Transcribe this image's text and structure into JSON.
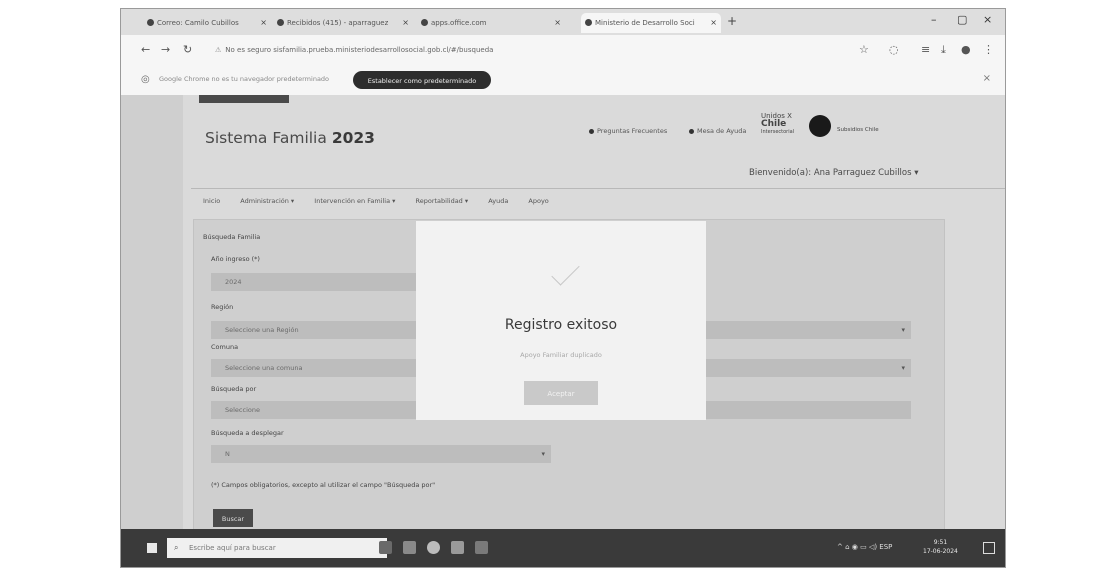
{
  "browser": {
    "tabs": [
      {
        "label": "Correo: Camilo Cubillos"
      },
      {
        "label": "Recibidos (415) - aparraguez"
      },
      {
        "label": "apps.office.com"
      },
      {
        "label": "Ministerio de Desarrollo Soci"
      }
    ],
    "new_tab": "+",
    "window_controls": [
      "–",
      "▢",
      "×"
    ],
    "url": "No es seguro   sisfamilia.prueba.ministeriodesarrollosocial.gob.cl/#/busqueda",
    "infobar": {
      "text": "Google Chrome no es tu navegador predeterminado",
      "button": "Establecer como predeterminado",
      "close": "×"
    }
  },
  "site": {
    "title_prefix": "Sistema Familia",
    "title_year": "2023",
    "links": [
      "Preguntas Frecuentes",
      "Mesa de Ayuda"
    ],
    "logo_text": [
      "Unidos X",
      "Chile",
      "Intersectorial"
    ],
    "logo_small": "Subsidios Chile",
    "welcome": "Bienvenido(a): Ana Parraguez Cubillos ▾",
    "menu": [
      "Inicio",
      "Administración ▾",
      "Intervención en Familia ▾",
      "Reportabilidad ▾",
      "Ayuda",
      "Apoyo"
    ]
  },
  "form": {
    "title": "Búsqueda Familia",
    "fields": [
      {
        "label": "Año ingreso (*)",
        "value": "2024"
      },
      {
        "label": "Región",
        "value": "Seleccione una Región"
      },
      {
        "label": "Comuna",
        "value": "Seleccione una comuna"
      },
      {
        "label": "Búsqueda por",
        "value": "Seleccione"
      },
      {
        "label": "Búsqueda a desplegar",
        "value": "N"
      }
    ],
    "note": "(*) Campos obligatorios, excepto al utilizar el campo \"Búsqueda por\"",
    "search_button": "Buscar"
  },
  "modal": {
    "title": "Registro exitoso",
    "subtitle": "Apoyo Familiar duplicado",
    "button": "Aceptar"
  },
  "taskbar": {
    "search_placeholder": "Escribe aquí para buscar",
    "tray": "^ ⌂ ◉ ▭ ◁)  ESP",
    "time": "9:51",
    "date": "17-06-2024"
  }
}
